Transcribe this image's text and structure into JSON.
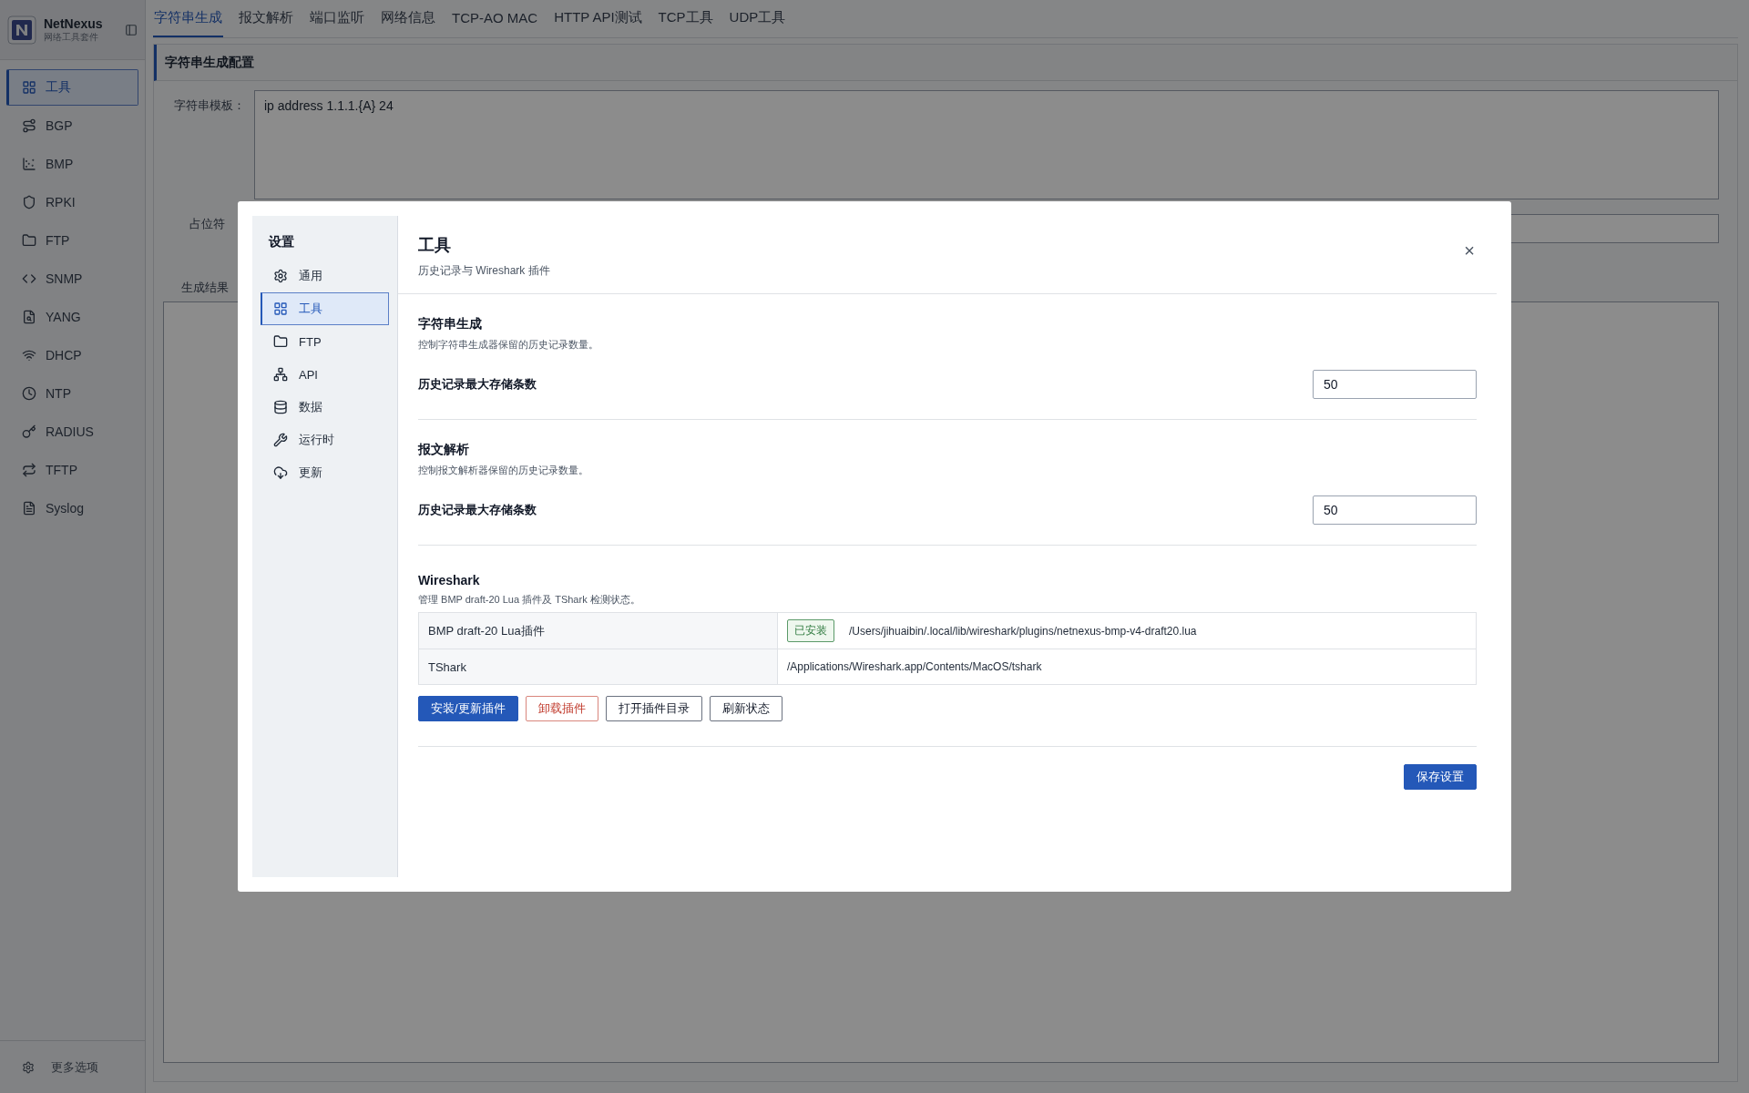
{
  "app": {
    "name": "NetNexus",
    "subtitle": "网络工具套件"
  },
  "sidebar": {
    "items": [
      {
        "label": "工具",
        "selected": true
      },
      {
        "label": "BGP",
        "selected": false
      },
      {
        "label": "BMP",
        "selected": false
      },
      {
        "label": "RPKI",
        "selected": false
      },
      {
        "label": "FTP",
        "selected": false
      },
      {
        "label": "SNMP",
        "selected": false
      },
      {
        "label": "YANG",
        "selected": false
      },
      {
        "label": "DHCP",
        "selected": false
      },
      {
        "label": "NTP",
        "selected": false
      },
      {
        "label": "RADIUS",
        "selected": false
      },
      {
        "label": "TFTP",
        "selected": false
      },
      {
        "label": "Syslog",
        "selected": false
      }
    ],
    "footer": "更多选项"
  },
  "tabs": [
    {
      "label": "字符串生成",
      "selected": true
    },
    {
      "label": "报文解析",
      "selected": false
    },
    {
      "label": "端口监听",
      "selected": false
    },
    {
      "label": "网络信息",
      "selected": false
    },
    {
      "label": "TCP-AO MAC",
      "selected": false
    },
    {
      "label": "HTTP API测试",
      "selected": false
    },
    {
      "label": "TCP工具",
      "selected": false
    },
    {
      "label": "UDP工具",
      "selected": false
    }
  ],
  "panel": {
    "title": "字符串生成配置",
    "template_label": "字符串模板：",
    "template_value": "ip address 1.1.1.{A} 24",
    "placeholder_label": "占位符",
    "result_label": "生成结果"
  },
  "dialog": {
    "nav_title": "设置",
    "nav": [
      {
        "label": "通用",
        "selected": false
      },
      {
        "label": "工具",
        "selected": true
      },
      {
        "label": "FTP",
        "selected": false
      },
      {
        "label": "API",
        "selected": false
      },
      {
        "label": "数据",
        "selected": false
      },
      {
        "label": "运行时",
        "selected": false
      },
      {
        "label": "更新",
        "selected": false
      }
    ],
    "title": "工具",
    "subtitle": "历史记录与 Wireshark 插件",
    "close": "×",
    "sections": [
      {
        "title": "字符串生成",
        "description": "控制字符串生成器保留的历史记录数量。",
        "field_label": "历史记录最大存储条数",
        "value": "50"
      },
      {
        "title": "报文解析",
        "description": "控制报文解析器保留的历史记录数量。",
        "field_label": "历史记录最大存储条数",
        "value": "50"
      }
    ],
    "wireshark": {
      "title": "Wireshark",
      "description": "管理 BMP draft-20 Lua 插件及 TShark 检测状态。",
      "rows": [
        {
          "name": "BMP draft-20 Lua插件",
          "badge": "已安装",
          "path": "/Users/jihuaibin/.local/lib/wireshark/plugins/netnexus-bmp-v4-draft20.lua"
        },
        {
          "name": "TShark",
          "path": "/Applications/Wireshark.app/Contents/MacOS/tshark"
        }
      ],
      "buttons": [
        {
          "label": "安装/更新插件",
          "kind": "primary"
        },
        {
          "label": "卸载插件",
          "kind": "danger"
        },
        {
          "label": "打开插件目录",
          "kind": "default"
        },
        {
          "label": "刷新状态",
          "kind": "default"
        }
      ]
    },
    "save_button": "保存设置"
  }
}
